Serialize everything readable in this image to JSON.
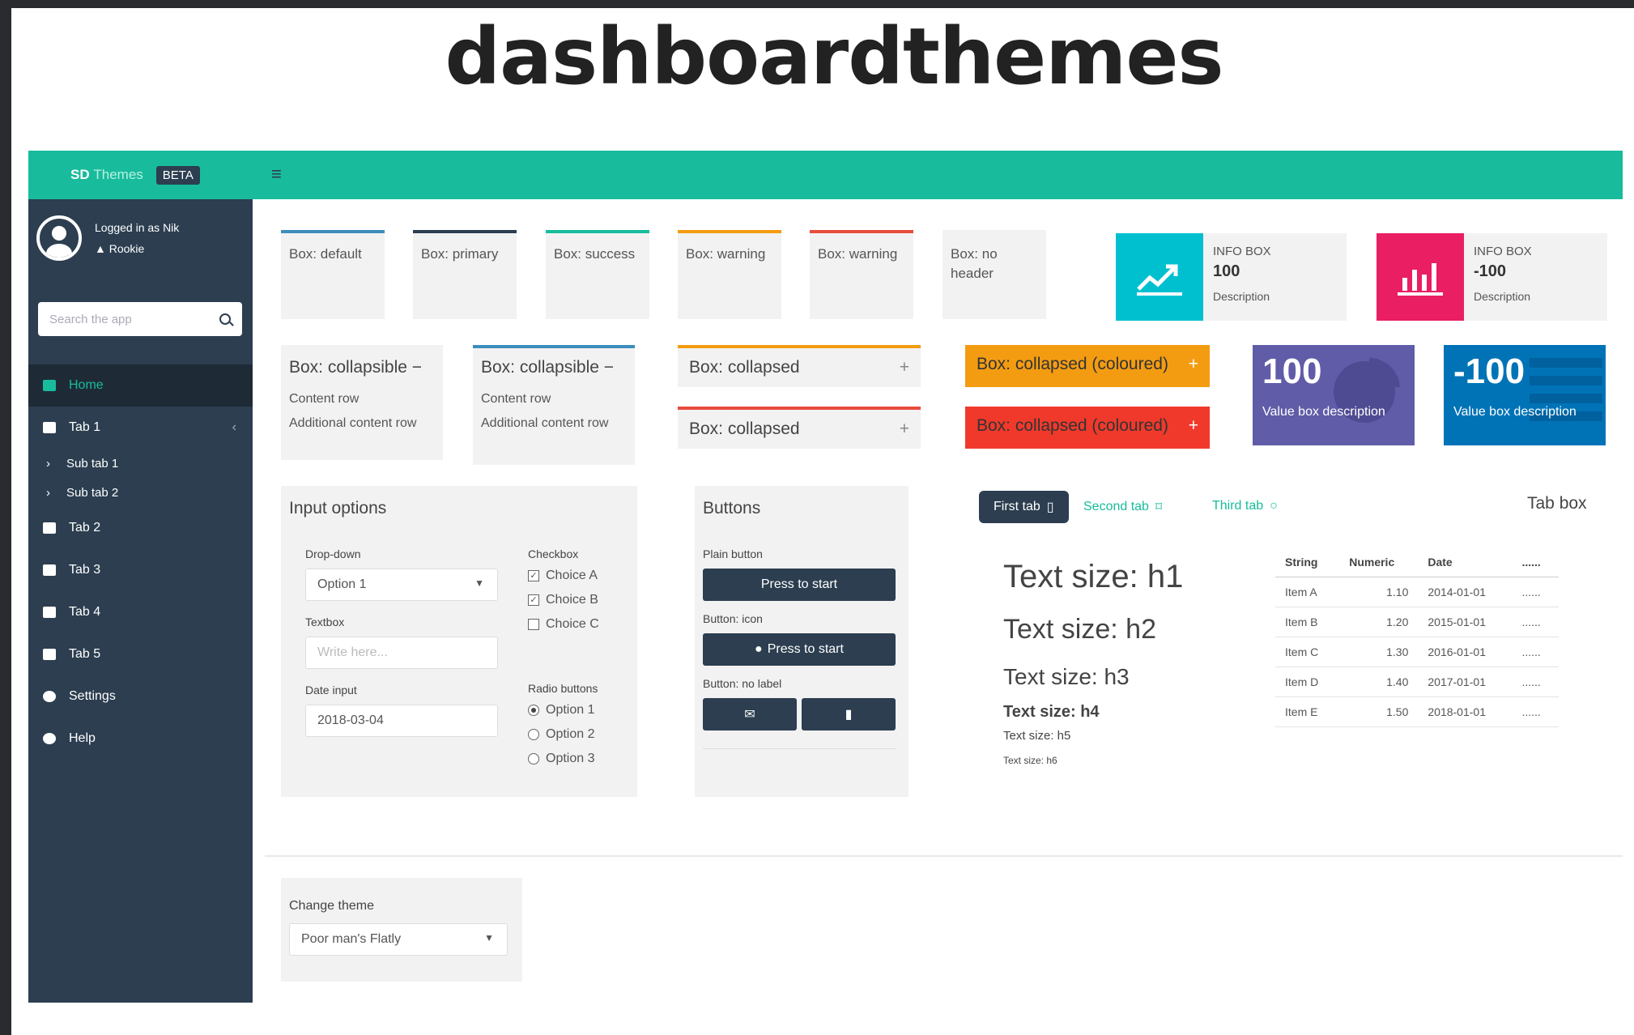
{
  "slide_title": "dashboardthemes",
  "header": {
    "logo_brand": "SD",
    "logo_rest": "Themes",
    "badge": "BETA"
  },
  "sidebar": {
    "user_line1": "Logged in as Nik",
    "user_line2": "Rookie",
    "search_placeholder": "Search the app",
    "items": [
      {
        "label": "Home"
      },
      {
        "label": "Tab 1"
      },
      {
        "label": "Sub tab 1"
      },
      {
        "label": "Sub tab 2"
      },
      {
        "label": "Tab 2"
      },
      {
        "label": "Tab 3"
      },
      {
        "label": "Tab 4"
      },
      {
        "label": "Tab 5"
      },
      {
        "label": "Settings"
      },
      {
        "label": "Help"
      }
    ]
  },
  "boxes_top": [
    {
      "label": "Box: default",
      "color": "#d2d6de"
    },
    {
      "label": "Box: primary",
      "color": "#2c3e50"
    },
    {
      "label": "Box: success",
      "color": "#18bc9c"
    },
    {
      "label": "Box: warning",
      "color": "#f39c12"
    },
    {
      "label": "Box: warning",
      "color": "#e74c3c"
    },
    {
      "label": "Box: no header",
      "color": "transparent"
    }
  ],
  "info_boxes": [
    {
      "title": "INFO BOX",
      "value": "100",
      "desc": "Description",
      "color": "#00c0d0",
      "icon": "line-chart-icon"
    },
    {
      "title": "INFO BOX",
      "value": "-100",
      "desc": "Description",
      "color": "#e91e63",
      "icon": "bar-chart-icon"
    }
  ],
  "collapsible": [
    {
      "title": "Box: collapsible",
      "rows": [
        "Content row",
        "Additional content row"
      ]
    },
    {
      "title": "Box: collapsible",
      "rows": [
        "Content row",
        "Additional content row"
      ]
    }
  ],
  "collapsed": [
    {
      "title": "Box: collapsed",
      "sign": "+"
    },
    {
      "title": "Box: collapsed",
      "sign": "+"
    },
    {
      "title": "Box: collapsed (coloured)",
      "sign": "+"
    },
    {
      "title": "Box: collapsed (coloured)",
      "sign": "+"
    }
  ],
  "value_boxes": [
    {
      "value": "100",
      "desc": "Value box description",
      "color": "#605ca8"
    },
    {
      "value": "-100",
      "desc": "Value box description",
      "color": "#0073b7"
    }
  ],
  "inputs": {
    "title": "Input options",
    "dropdown_label": "Drop-down",
    "dropdown_value": "Option 1",
    "textbox_label": "Textbox",
    "textbox_placeholder": "Write here...",
    "date_label": "Date input",
    "date_value": "2018-03-04",
    "checkbox_label": "Checkbox",
    "checkboxes": [
      "Choice A",
      "Choice B",
      "Choice C"
    ],
    "radio_label": "Radio buttons",
    "radios": [
      "Option 1",
      "Option 2",
      "Option 3"
    ]
  },
  "buttons": {
    "title": "Buttons",
    "plain_label": "Plain button",
    "plain_text": "Press to start",
    "icon_label": "Button: icon",
    "icon_text": "Press to start",
    "nolabel_label": "Button: no label"
  },
  "tabbox": {
    "tabs": [
      "First tab",
      "Second tab",
      "Third tab"
    ],
    "title": "Tab box",
    "text_sizes": [
      "Text size: h1",
      "Text size: h2",
      "Text size: h3",
      "Text size: h4",
      "Text size: h5",
      "Text size: h6"
    ],
    "columns": [
      "String",
      "Numeric",
      "Date",
      "......"
    ],
    "rows": [
      [
        "Item A",
        "1.10",
        "2014-01-01",
        "......"
      ],
      [
        "Item B",
        "1.20",
        "2015-01-01",
        "......"
      ],
      [
        "Item C",
        "1.30",
        "2016-01-01",
        "......"
      ],
      [
        "Item D",
        "1.40",
        "2017-01-01",
        "......"
      ],
      [
        "Item E",
        "1.50",
        "2018-01-01",
        "......"
      ]
    ]
  },
  "theme": {
    "label": "Change theme",
    "value": "Poor man's Flatly"
  }
}
